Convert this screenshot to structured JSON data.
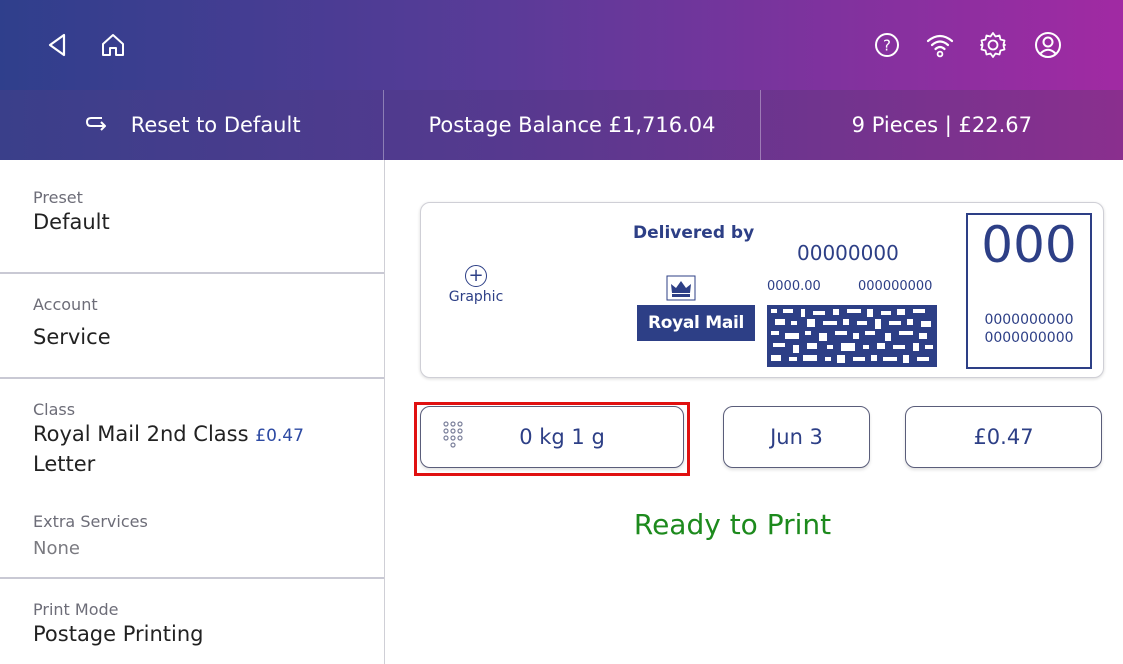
{
  "topbar": {
    "icons": [
      "back-icon",
      "home-icon",
      "help-icon",
      "wifi-icon",
      "settings-icon",
      "account-icon"
    ]
  },
  "strip": {
    "reset_label": "Reset to Default",
    "postage_balance": "Postage Balance £1,716.04",
    "pieces": "9 Pieces | £22.67"
  },
  "sidebar": {
    "preset": {
      "label": "Preset",
      "value": "Default"
    },
    "account": {
      "label": "Account",
      "value": "Service"
    },
    "class": {
      "label": "Class",
      "value_line1": "Royal Mail 2nd Class",
      "price": "£0.47",
      "value_line2": "Letter"
    },
    "extra_services": {
      "label": "Extra Services",
      "value": "None"
    },
    "print_mode": {
      "label": "Print Mode",
      "value": "Postage Printing"
    }
  },
  "indicia": {
    "graphic_plus": "+",
    "graphic_label": "Graphic",
    "delivered_by": "Delivered by",
    "logo_text": "Royal Mail",
    "number_main": "00000000",
    "number_sub1": "0000.00",
    "number_sub2": "000000000",
    "value_big": "000",
    "value_line1": "0000000000",
    "value_line2": "0000000000"
  },
  "controls": {
    "weight": "0 kg 1 g",
    "date": "Jun 3",
    "price": "£0.47"
  },
  "status": "Ready to Print",
  "colors": {
    "accent_blue": "#2d3f86",
    "ready_green": "#1d8a1d",
    "highlight_red": "#e01010"
  }
}
